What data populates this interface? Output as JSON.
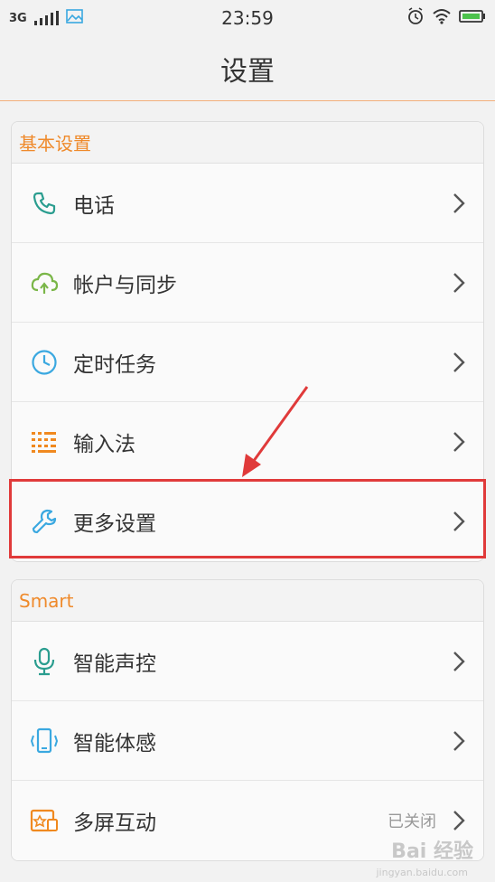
{
  "status_bar": {
    "network": "3G",
    "time": "23:59"
  },
  "header": {
    "title": "设置"
  },
  "sections": [
    {
      "title": "基本设置",
      "items": [
        {
          "label": "电话",
          "icon": "phone-icon"
        },
        {
          "label": "帐户与同步",
          "icon": "cloud-sync-icon"
        },
        {
          "label": "定时任务",
          "icon": "clock-icon"
        },
        {
          "label": "输入法",
          "icon": "keyboard-icon"
        },
        {
          "label": "更多设置",
          "icon": "wrench-icon"
        }
      ]
    },
    {
      "title": "Smart",
      "items": [
        {
          "label": "智能声控",
          "icon": "microphone-icon"
        },
        {
          "label": "智能体感",
          "icon": "motion-phone-icon"
        },
        {
          "label": "多屏互动",
          "icon": "multi-screen-icon",
          "value": "已关闭"
        }
      ]
    }
  ],
  "watermark": {
    "text": "Bai 经验",
    "sub": "jingyan.baidu.com"
  },
  "colors": {
    "accent": "#ef8a2b",
    "highlight": "#e03a3a",
    "teal": "#2a9d8f",
    "green": "#7ab648",
    "blue": "#3aa8e0",
    "orange": "#f0891f"
  }
}
